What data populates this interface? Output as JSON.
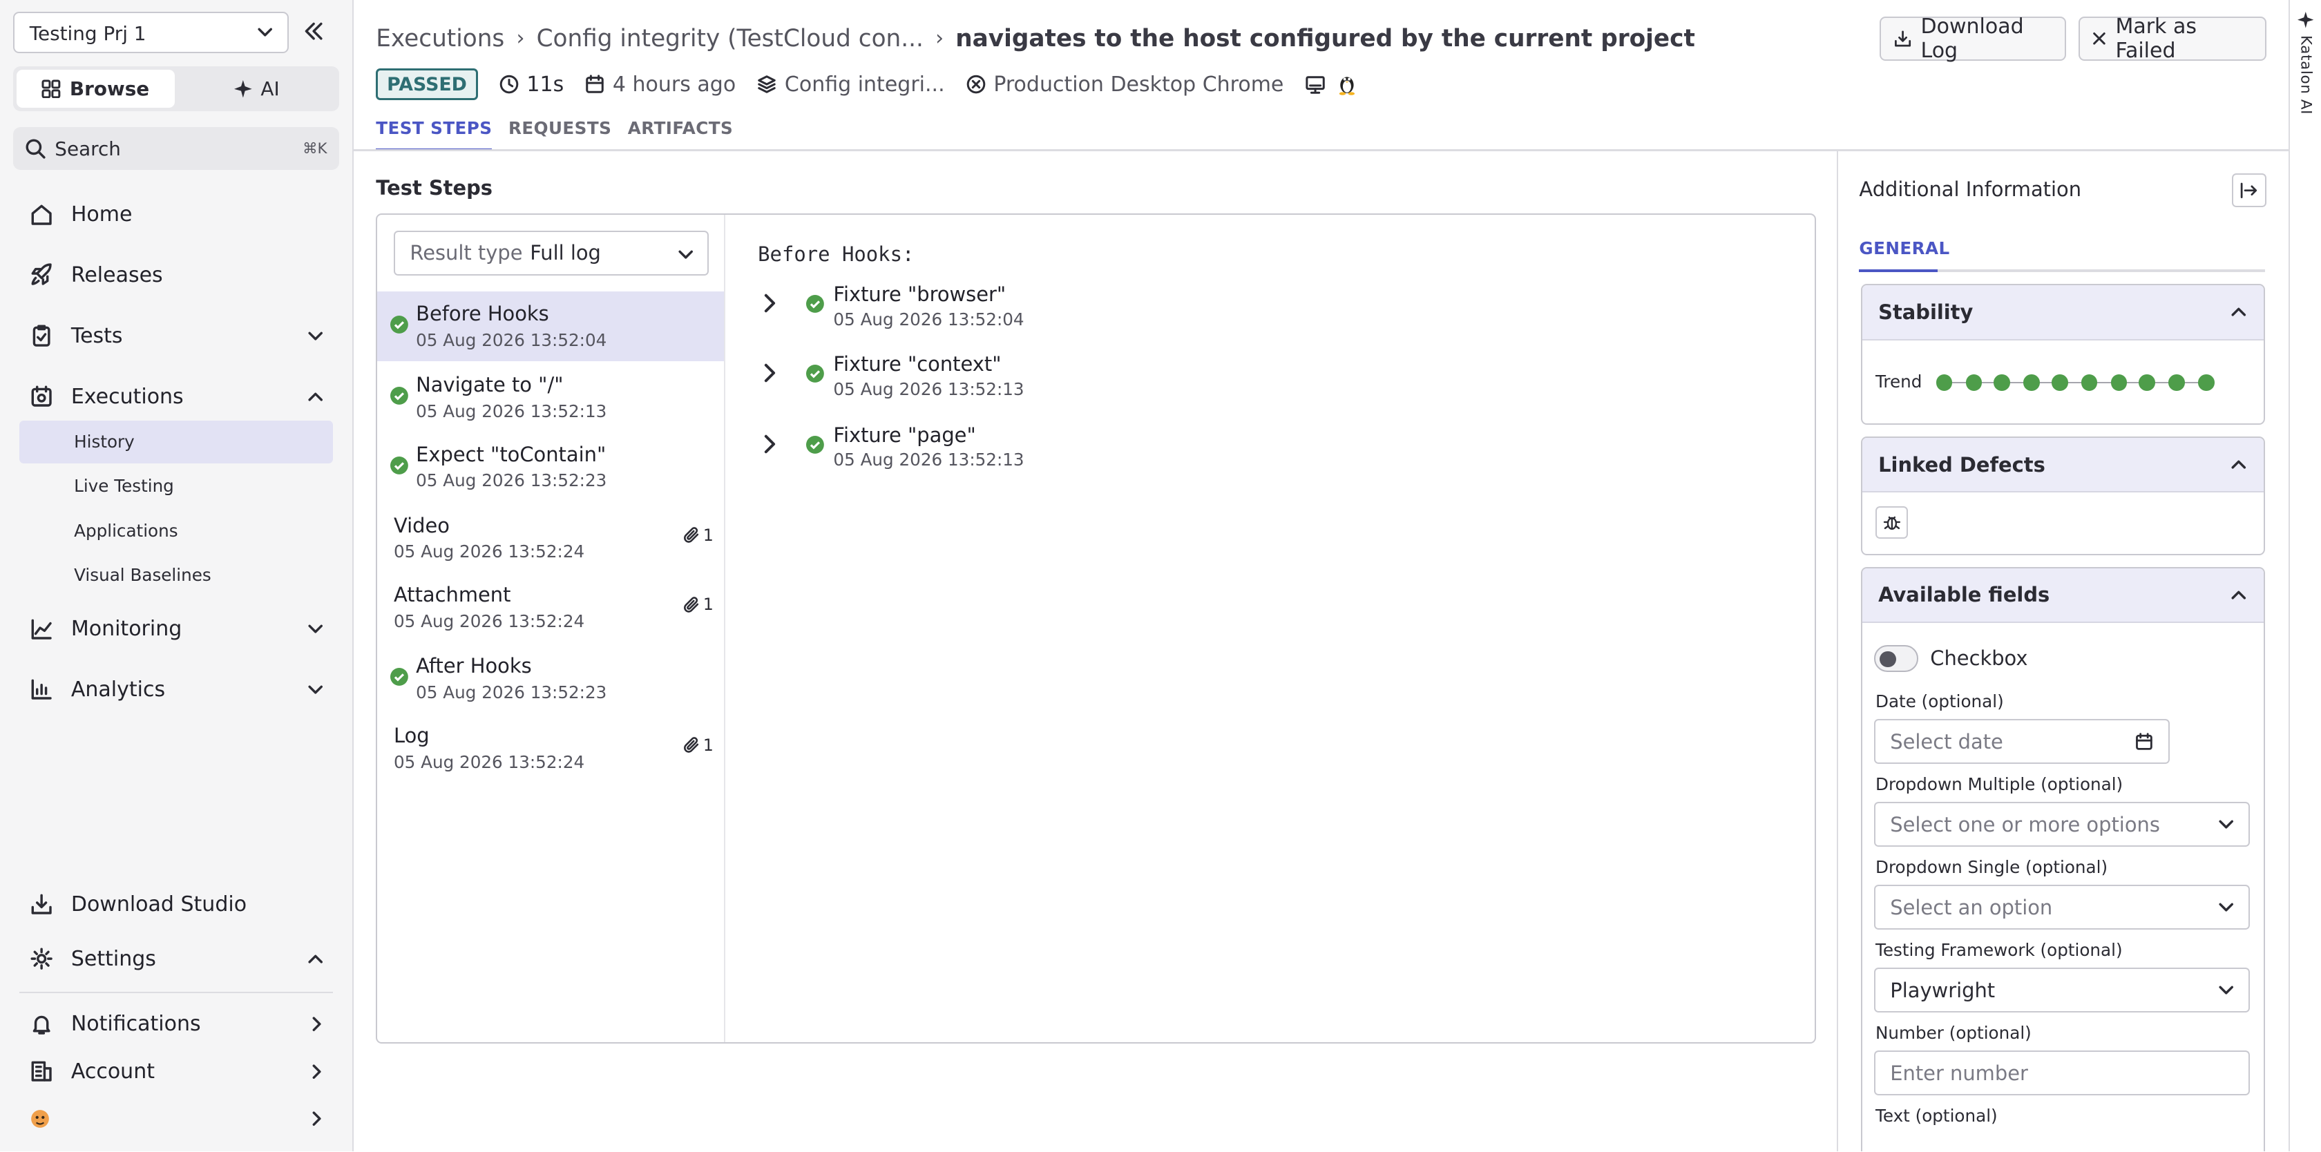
{
  "sidebar": {
    "project": "Testing Prj 1",
    "modes": {
      "browse": "Browse",
      "ai": "AI"
    },
    "search": {
      "placeholder": "Search",
      "shortcut": "⌘K"
    },
    "nav": {
      "home": "Home",
      "releases": "Releases",
      "tests": "Tests",
      "executions": "Executions",
      "executions_sub": [
        "History",
        "Live Testing",
        "Applications",
        "Visual Baselines"
      ],
      "monitoring": "Monitoring",
      "analytics": "Analytics",
      "download_studio": "Download Studio",
      "settings": "Settings",
      "notifications": "Notifications",
      "account": "Account"
    }
  },
  "header": {
    "breadcrumb": [
      "Executions",
      "Config integrity (TestCloud con...",
      "navigates to the host configured by the current project"
    ],
    "buttons": {
      "download_log": "Download Log",
      "mark_failed": "Mark as Failed"
    },
    "meta": {
      "status": "PASSED",
      "duration": "11s",
      "time_ago": "4 hours ago",
      "suite": "Config integri...",
      "environment": "Production Desktop Chrome"
    },
    "tabs": [
      "TEST STEPS",
      "REQUESTS",
      "ARTIFACTS"
    ]
  },
  "steps": {
    "title": "Test Steps",
    "result_type": {
      "label": "Result type",
      "value": "Full log"
    },
    "items": [
      {
        "name": "Before Hooks",
        "time": "05 Aug 2026 13:52:04"
      },
      {
        "name": "Navigate to \"/\"",
        "time": "05 Aug 2026 13:52:13"
      },
      {
        "name": "Expect \"toContain\"",
        "time": "05 Aug 2026 13:52:23"
      },
      {
        "name": "Video",
        "time": "05 Aug 2026 13:52:24",
        "attachments": "1"
      },
      {
        "name": "Attachment",
        "time": "05 Aug 2026 13:52:24",
        "attachments": "1"
      },
      {
        "name": "After Hooks",
        "time": "05 Aug 2026 13:52:23"
      },
      {
        "name": "Log",
        "time": "05 Aug 2026 13:52:24",
        "attachments": "1"
      }
    ],
    "detail": {
      "heading": "Before Hooks:",
      "fixtures": [
        {
          "name": "Fixture \"browser\"",
          "time": "05 Aug 2026 13:52:04"
        },
        {
          "name": "Fixture \"context\"",
          "time": "05 Aug 2026 13:52:13"
        },
        {
          "name": "Fixture \"page\"",
          "time": "05 Aug 2026 13:52:13"
        }
      ]
    }
  },
  "info": {
    "title": "Additional Information",
    "tab": "GENERAL",
    "stability": {
      "title": "Stability",
      "trend_label": "Trend"
    },
    "linked_defects": {
      "title": "Linked Defects"
    },
    "fields": {
      "title": "Available fields",
      "checkbox": "Checkbox",
      "date_label": "Date (optional)",
      "date_placeholder": "Select date",
      "dd_multi_label": "Dropdown Multiple (optional)",
      "dd_multi_placeholder": "Select one or more options",
      "dd_single_label": "Dropdown Single (optional)",
      "dd_single_placeholder": "Select an option",
      "framework_label": "Testing Framework (optional)",
      "framework_value": "Playwright",
      "number_label": "Number (optional)",
      "number_placeholder": "Enter number",
      "text_label": "Text (optional)"
    }
  },
  "katalon_tab": "Katalon AI"
}
